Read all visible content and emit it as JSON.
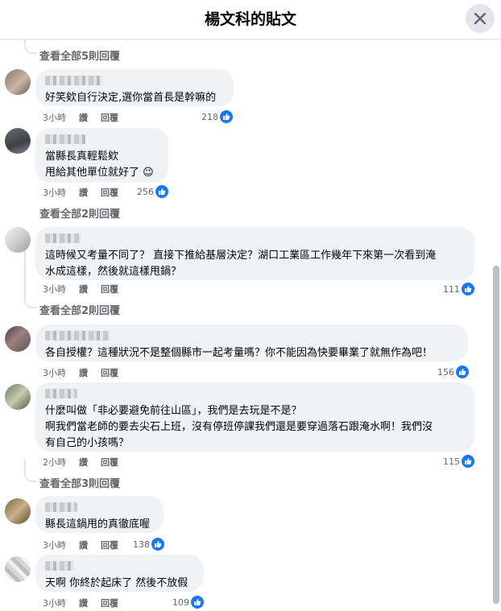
{
  "header": {
    "title": "楊文科的貼文"
  },
  "thread_links": [
    "查看全部5則回覆",
    "查看全部2則回覆",
    "查看全部2則回覆",
    "查看全部3則回覆"
  ],
  "comments": [
    {
      "text": "好笑欸自行決定,選你當首長是幹嘛的",
      "time": "3小時",
      "like": "讚",
      "reply": "回覆",
      "count": "218"
    },
    {
      "text": "當縣長真輕鬆欸\n甩給其他單位就好了 😉",
      "time": "3小時",
      "like": "讚",
      "reply": "回覆",
      "count": "256"
    },
    {
      "text": "這時候又考量不同了？ 直接下推給基層決定？湖口工業區工作幾年下來第一次看到淹\n水成這樣，然後就這樣甩鍋？",
      "time": "3小時",
      "like": "讚",
      "reply": "回覆",
      "count": "111"
    },
    {
      "text": "各自授權？這種狀況不是整個縣市一起考量嗎？你不能因為快要畢業了就無作為吧！",
      "time": "3小時",
      "like": "讚",
      "reply": "回覆",
      "count": "156"
    },
    {
      "text": "什麼叫做「非必要避免前往山區」，我們是去玩是不是？\n啊我們當老師的要去尖石上班，沒有停班停課我們還是要穿過落石跟淹水啊！我們沒\n有自己的小孩嗎？",
      "time": "2小時",
      "like": "讚",
      "reply": "回覆",
      "count": "115"
    },
    {
      "text": "縣長這鍋甩的真徹底喔",
      "time": "3小時",
      "like": "讚",
      "reply": "回覆",
      "count": "138"
    },
    {
      "text": "天啊 你終於起床了 然後不放假",
      "time": "3小時",
      "like": "讚",
      "reply": "回覆",
      "count": "109"
    }
  ],
  "colors": {
    "accent": "#1877f2",
    "bubble": "#f0f2f5",
    "secondary_text": "#65676b"
  }
}
